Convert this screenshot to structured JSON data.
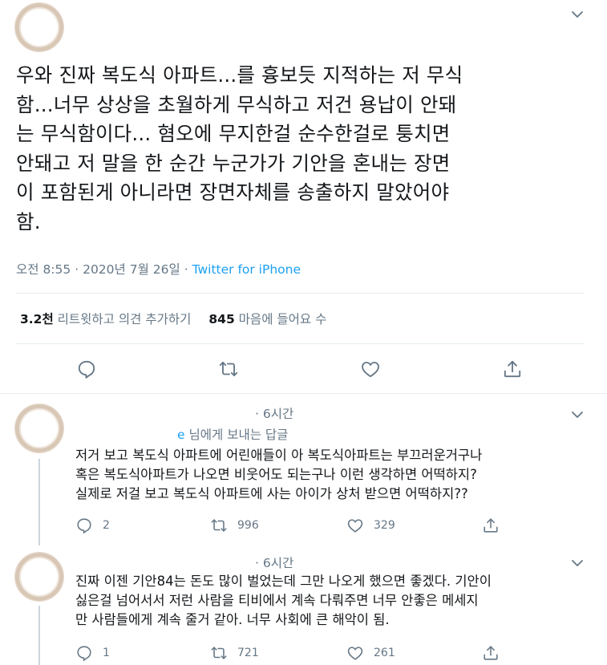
{
  "tweet": {
    "text": "우와 진짜 복도식 아파트...를 흉보듯 지적하는 저 무식\n함...너무 상상을 초월하게 무식하고 저건 용납이 안돼\n는 무식함이다... 혐오에 무지한걸 순수한걸로 퉁치면\n안돼고 저 말을 한 순간 누군가가 기안을 혼내는 장면\n이 포함된게 아니라면 장면자체를 송출하지 말았어야\n함.",
    "time": "오전 8:55",
    "separator": "·",
    "date": "2020년 7월 26일",
    "source": "Twitter for iPhone",
    "retweet_count": "3.2천",
    "retweet_label": "리트윗하고 의견 추가하기",
    "like_count": "845",
    "like_label": "마음에 들어요 수"
  },
  "replies": [
    {
      "time": "· 6시간",
      "reply_to_handle": "e",
      "reply_to_suffix": "님에게 보내는 답글",
      "text": "저거 보고 복도식 아파트에 어린애들이 아 복도식아파트는 부끄러운거구나\n혹은 복도식아파트가 나오면 비웃어도 되는구나 이런 생각하면 어떡하지?\n실제로 저걸 보고 복도식 아파트에 사는 아이가 상처 받으면 어떡하지??",
      "reply_count": "2",
      "retweet_count": "996",
      "like_count": "329"
    },
    {
      "time": "· 6시간",
      "text": "진짜 이젠 기안84는 돈도 많이 벌었는데 그만 나오게 했으면 좋겠다. 기안이\n싫은걸 넘어서서 저런 사람을 티비에서 계속 다뤄주면 너무 안좋은 메세지\n만 사람들에게 계속 줄거 같아. 너무 사회에 큰 해악이 됨.",
      "reply_count": "1",
      "retweet_count": "721",
      "like_count": "261"
    }
  ],
  "icons": {
    "chevron": "chevron-down-icon",
    "reply": "reply-icon",
    "retweet": "retweet-icon",
    "like": "heart-icon",
    "share": "share-icon"
  },
  "colors": {
    "link": "#1da1f2",
    "secondary_text": "#657786",
    "divider": "#e6ecf0"
  }
}
